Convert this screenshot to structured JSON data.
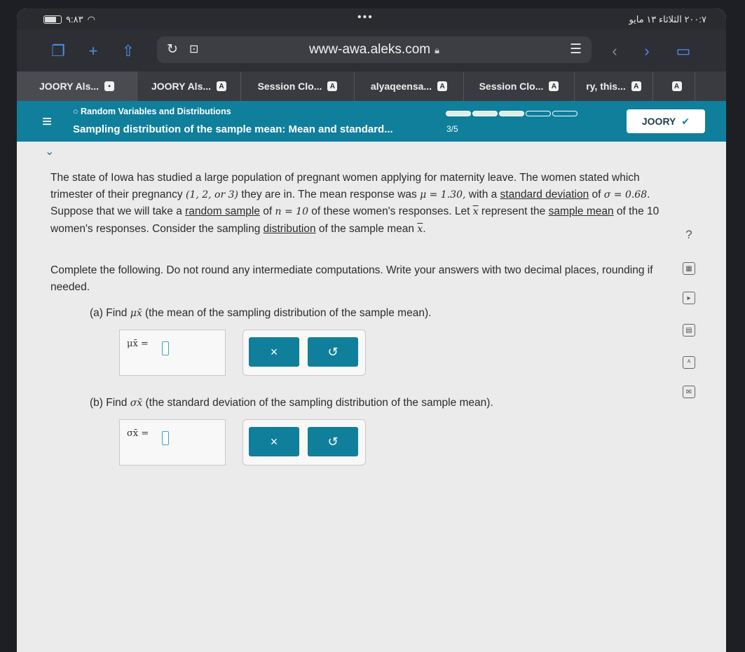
{
  "status_bar": {
    "left_text": "٩:٨٣",
    "right_text": "٢٠٠:٧ الثلاثاء ١٣ مايو"
  },
  "browser": {
    "url": "www-awa.aleks.com",
    "icons": [
      "tabs-icon",
      "new-tab-icon",
      "share-icon",
      "reload-icon",
      "reader-icon",
      "bookmark-icon",
      "back-icon",
      "forward-icon",
      "sidebar-icon"
    ]
  },
  "tabs": [
    {
      "label": "JOORY Als...",
      "badge": "▪"
    },
    {
      "label": "JOORY Als...",
      "badge": "A"
    },
    {
      "label": "Session Clo...",
      "badge": "A"
    },
    {
      "label": "alyaqeensa...",
      "badge": "A"
    },
    {
      "label": "Session Clo...",
      "badge": "A"
    },
    {
      "label": "ry, this...",
      "badge": "A"
    },
    {
      "label": "",
      "badge": "A"
    }
  ],
  "header": {
    "topic_small": "Random Variables and Distributions",
    "topic_title": "Sampling distribution of the sample mean: Mean and standard...",
    "progress_label": "3/5",
    "progress_total": 5,
    "progress_done": 3,
    "user_name": "JOORY"
  },
  "problem": {
    "p1_a": "The state of Iowa has studied a large population of pregnant women applying for maternity leave. The women stated which trimester of their pregnancy ",
    "p1_set": "(1, 2, or 3)",
    "p1_b": " they are in. The mean response was ",
    "p1_mu": "μ = 1.30,",
    "p1_c": " with a ",
    "p1_link_sd": "standard deviation",
    "p1_d": " of ",
    "p1_sigma": "σ = 0.68",
    "p1_e": ". Suppose that we will take a ",
    "p1_link_rs": "random sample",
    "p1_f": " of ",
    "p1_n": "n = 10",
    "p1_g": " of these women's responses. Let ",
    "p1_x": "x",
    "p1_h": " represent the ",
    "p1_link_sm": "sample mean",
    "p1_i": " of the 10 women's responses. Consider the sampling ",
    "p1_link_dist": "distribution",
    "p1_j": " of the sample mean ",
    "p1_x2": "x",
    "p1_k": ".",
    "p2": "Complete the following. Do not round any intermediate computations. Write your answers with two decimal places, rounding if needed."
  },
  "part_a": {
    "prefix": "(a)  Find ",
    "symbol": "μx̄",
    "desc": " (the mean of the sampling distribution of the sample mean).",
    "answer_symbol": "μx̄ =",
    "value": ""
  },
  "part_b": {
    "prefix": "(b)  Find ",
    "symbol": "σx̄",
    "desc": " (the standard deviation of the sampling distribution of the sample mean).",
    "answer_symbol": "σx̄ =",
    "value": ""
  },
  "buttons": {
    "clear": "×",
    "undo": "↺"
  },
  "colors": {
    "aleks_teal": "#0f7f9c",
    "browser_blue": "#4a8ff0"
  }
}
